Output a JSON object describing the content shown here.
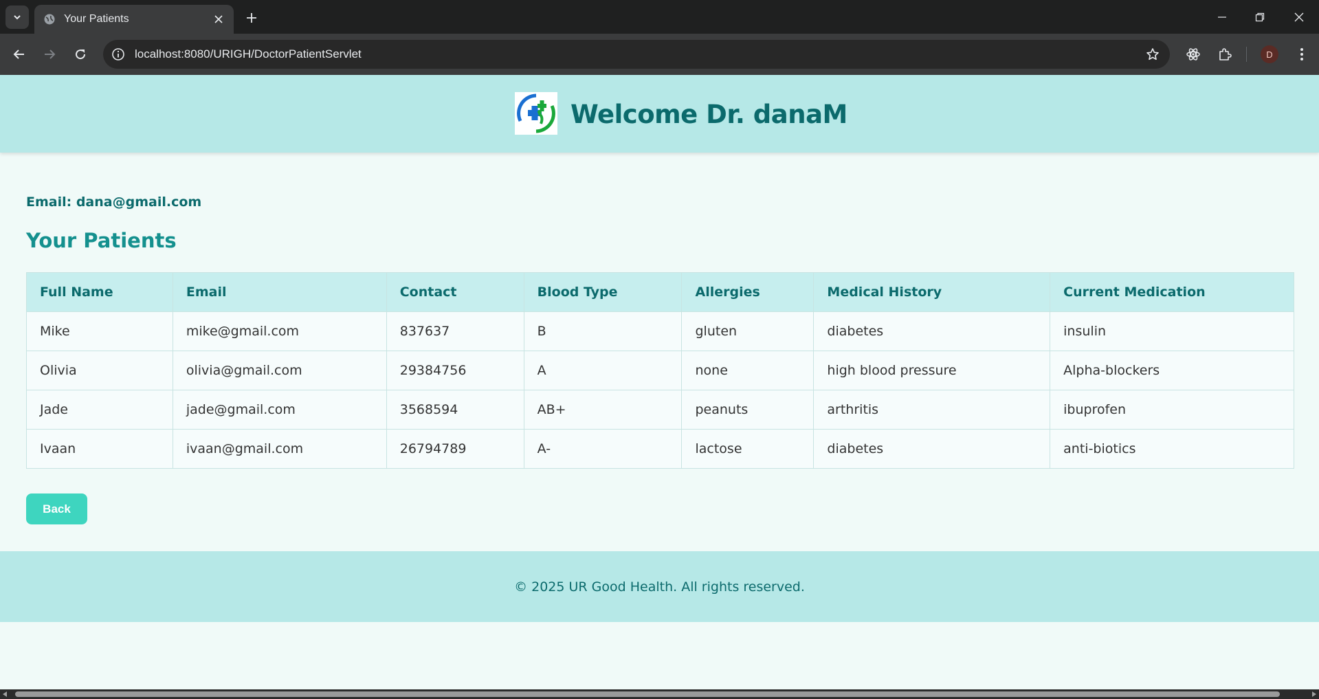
{
  "browser": {
    "tab_title": "Your Patients",
    "url": "localhost:8080/URIGH/DoctorPatientServlet",
    "profile_initial": "D"
  },
  "header": {
    "welcome": "Welcome Dr. danaM"
  },
  "doctor": {
    "email_line": "Email: dana@gmail.com"
  },
  "section_title": "Your Patients",
  "table": {
    "columns": [
      "Full Name",
      "Email",
      "Contact",
      "Blood Type",
      "Allergies",
      "Medical History",
      "Current Medication"
    ],
    "rows": [
      [
        "Mike",
        "mike@gmail.com",
        "837637",
        "B",
        "gluten",
        "diabetes",
        "insulin"
      ],
      [
        "Olivia",
        "olivia@gmail.com",
        "29384756",
        "A",
        "none",
        "high blood pressure",
        "Alpha-blockers"
      ],
      [
        "Jade",
        "jade@gmail.com",
        "3568594",
        "AB+",
        "peanuts",
        "arthritis",
        "ibuprofen"
      ],
      [
        "Ivaan",
        "ivaan@gmail.com",
        "26794789",
        "A-",
        "lactose",
        "diabetes",
        "anti-biotics"
      ]
    ]
  },
  "back_label": "Back",
  "footer": {
    "text": "© 2025 UR Good Health. All rights reserved."
  },
  "colors": {
    "header_bg": "#b6e8e7",
    "accent": "#0b6a6c",
    "button": "#3ed5bf",
    "page_bg": "#f0faf8"
  }
}
